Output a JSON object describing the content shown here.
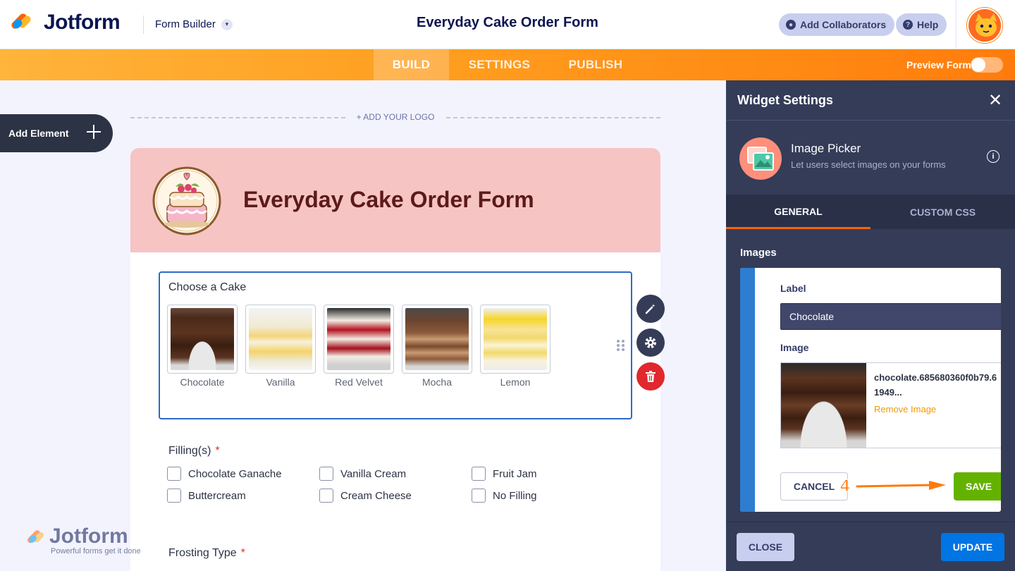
{
  "header": {
    "logo_text": "Jotform",
    "mode_label": "Form Builder",
    "form_title": "Everyday Cake Order Form",
    "collaborators_label": "Add Collaborators",
    "help_label": "Help"
  },
  "nav": {
    "tabs": [
      {
        "label": "BUILD",
        "active": true
      },
      {
        "label": "SETTINGS",
        "active": false
      },
      {
        "label": "PUBLISH",
        "active": false
      }
    ],
    "preview_label": "Preview Form",
    "preview_enabled": false
  },
  "builder": {
    "add_element_label": "Add Element",
    "add_logo_label": "+ ADD YOUR LOGO",
    "form_heading": "Everyday Cake Order Form",
    "image_question": {
      "label": "Choose a Cake",
      "options": [
        "Chocolate",
        "Vanilla",
        "Red Velvet",
        "Mocha",
        "Lemon"
      ]
    },
    "filling": {
      "label": "Filling(s)",
      "required_mark": "*",
      "options": [
        "Chocolate Ganache",
        "Vanilla Cream",
        "Fruit Jam",
        "Buttercream",
        "Cream Cheese",
        "No Filling"
      ]
    },
    "frosting": {
      "label": "Frosting Type",
      "required_mark": "*"
    },
    "watermark": {
      "title": "Jotform",
      "tagline": "Powerful forms get it done"
    }
  },
  "panel": {
    "title": "Widget Settings",
    "widget_name": "Image Picker",
    "widget_desc": "Let users select images on your forms",
    "tabs": [
      "GENERAL",
      "CUSTOM CSS"
    ],
    "section_title": "Images",
    "label_heading": "Label",
    "label_value": "Chocolate",
    "image_heading": "Image",
    "file_name": "chocolate.685680360f0b79.61949...",
    "remove_label": "Remove Image",
    "cancel_label": "CANCEL",
    "save_label": "SAVE",
    "step_number": "4",
    "close_label": "CLOSE",
    "update_label": "UPDATE"
  },
  "colors": {
    "accent_orange": "#ff7c0c",
    "header_pink": "#f7c4c4",
    "save_green": "#64b200",
    "update_blue": "#0075e3",
    "selection_blue": "#2e69c7"
  }
}
